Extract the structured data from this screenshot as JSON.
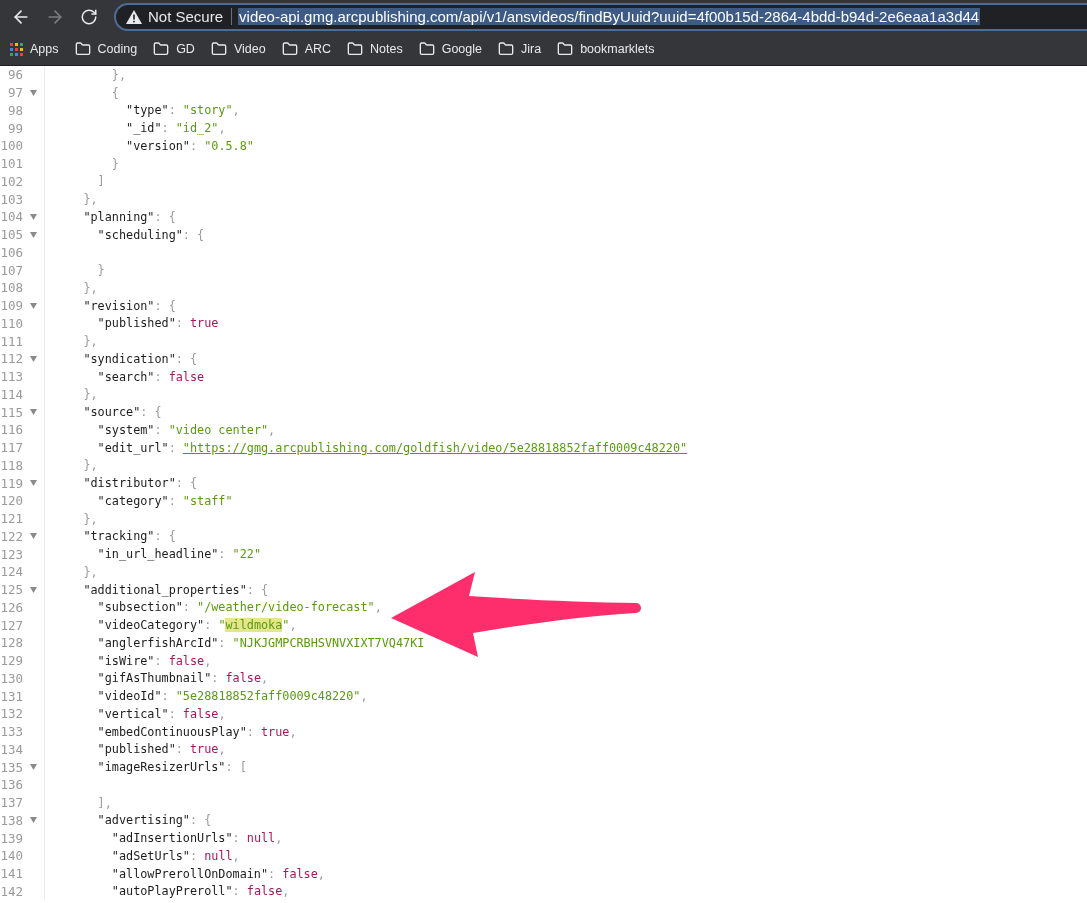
{
  "toolbar": {
    "security_label": "Not Secure",
    "url": "video-api.gmg.arcpublishing.com/api/v1/ansvideos/findByUuid?uuid=4f00b15d-2864-4bdd-b94d-2e6eaa1a3d44",
    "url_selected": true,
    "forward_disabled": true
  },
  "bookmarks": [
    {
      "label": "Apps",
      "kind": "apps"
    },
    {
      "label": "Coding",
      "kind": "folder"
    },
    {
      "label": "GD",
      "kind": "folder"
    },
    {
      "label": "Video",
      "kind": "folder"
    },
    {
      "label": "ARC",
      "kind": "folder"
    },
    {
      "label": "Notes",
      "kind": "folder"
    },
    {
      "label": "Google",
      "kind": "folder"
    },
    {
      "label": "Jira",
      "kind": "folder"
    },
    {
      "label": "bookmarklets",
      "kind": "folder"
    }
  ],
  "code": {
    "lines": [
      {
        "n": "96",
        "foldable": false,
        "text": [
          {
            "kind": "punct",
            "s": "        },"
          }
        ]
      },
      {
        "n": "97",
        "foldable": true,
        "text": [
          {
            "kind": "punct",
            "s": "        {"
          }
        ]
      },
      {
        "n": "98",
        "foldable": false,
        "text": [
          {
            "kind": "key",
            "s": "          \"type\""
          },
          {
            "kind": "punct",
            "s": ": "
          },
          {
            "kind": "str",
            "s": "\"story\""
          },
          {
            "kind": "punct",
            "s": ","
          }
        ]
      },
      {
        "n": "99",
        "foldable": false,
        "text": [
          {
            "kind": "key",
            "s": "          \"_id\""
          },
          {
            "kind": "punct",
            "s": ": "
          },
          {
            "kind": "str",
            "s": "\"id_2\""
          },
          {
            "kind": "punct",
            "s": ","
          }
        ]
      },
      {
        "n": "100",
        "foldable": false,
        "text": [
          {
            "kind": "key",
            "s": "          \"version\""
          },
          {
            "kind": "punct",
            "s": ": "
          },
          {
            "kind": "str",
            "s": "\"0.5.8\""
          }
        ]
      },
      {
        "n": "101",
        "foldable": false,
        "text": [
          {
            "kind": "punct",
            "s": "        }"
          }
        ]
      },
      {
        "n": "102",
        "foldable": false,
        "text": [
          {
            "kind": "punct",
            "s": "      ]"
          }
        ]
      },
      {
        "n": "103",
        "foldable": false,
        "text": [
          {
            "kind": "punct",
            "s": "    },"
          }
        ]
      },
      {
        "n": "104",
        "foldable": true,
        "text": [
          {
            "kind": "key",
            "s": "    \"planning\""
          },
          {
            "kind": "punct",
            "s": ": {"
          }
        ]
      },
      {
        "n": "105",
        "foldable": true,
        "text": [
          {
            "kind": "key",
            "s": "      \"scheduling\""
          },
          {
            "kind": "punct",
            "s": ": {"
          }
        ]
      },
      {
        "n": "106",
        "foldable": false
      },
      {
        "n": "107",
        "foldable": false,
        "text": [
          {
            "kind": "punct",
            "s": "      }"
          }
        ]
      },
      {
        "n": "108",
        "foldable": false,
        "text": [
          {
            "kind": "punct",
            "s": "    },"
          }
        ]
      },
      {
        "n": "109",
        "foldable": true,
        "text": [
          {
            "kind": "key",
            "s": "    \"revision\""
          },
          {
            "kind": "punct",
            "s": ": {"
          }
        ]
      },
      {
        "n": "110",
        "foldable": false,
        "text": [
          {
            "kind": "key",
            "s": "      \"published\""
          },
          {
            "kind": "punct",
            "s": ": "
          },
          {
            "kind": "lit",
            "s": "true"
          }
        ]
      },
      {
        "n": "111",
        "foldable": false,
        "text": [
          {
            "kind": "punct",
            "s": "    },"
          }
        ]
      },
      {
        "n": "112",
        "foldable": true,
        "text": [
          {
            "kind": "key",
            "s": "    \"syndication\""
          },
          {
            "kind": "punct",
            "s": ": {"
          }
        ]
      },
      {
        "n": "113",
        "foldable": false,
        "text": [
          {
            "kind": "key",
            "s": "      \"search\""
          },
          {
            "kind": "punct",
            "s": ": "
          },
          {
            "kind": "lit",
            "s": "false"
          }
        ]
      },
      {
        "n": "114",
        "foldable": false,
        "text": [
          {
            "kind": "punct",
            "s": "    },"
          }
        ]
      },
      {
        "n": "115",
        "foldable": true,
        "text": [
          {
            "kind": "key",
            "s": "    \"source\""
          },
          {
            "kind": "punct",
            "s": ": {"
          }
        ]
      },
      {
        "n": "116",
        "foldable": false,
        "text": [
          {
            "kind": "key",
            "s": "      \"system\""
          },
          {
            "kind": "punct",
            "s": ": "
          },
          {
            "kind": "str",
            "s": "\"video center\""
          },
          {
            "kind": "punct",
            "s": ","
          }
        ]
      },
      {
        "n": "117",
        "foldable": false,
        "text": [
          {
            "kind": "key",
            "s": "      \"edit_url\""
          },
          {
            "kind": "punct",
            "s": ": "
          },
          {
            "kind": "link",
            "s": "\"https://gmg.arcpublishing.com/goldfish/video/5e28818852faff0009c48220\""
          }
        ]
      },
      {
        "n": "118",
        "foldable": false,
        "text": [
          {
            "kind": "punct",
            "s": "    },"
          }
        ]
      },
      {
        "n": "119",
        "foldable": true,
        "text": [
          {
            "kind": "key",
            "s": "    \"distributor\""
          },
          {
            "kind": "punct",
            "s": ": {"
          }
        ]
      },
      {
        "n": "120",
        "foldable": false,
        "text": [
          {
            "kind": "key",
            "s": "      \"category\""
          },
          {
            "kind": "punct",
            "s": ": "
          },
          {
            "kind": "str",
            "s": "\"staff\""
          }
        ]
      },
      {
        "n": "121",
        "foldable": false,
        "text": [
          {
            "kind": "punct",
            "s": "    },"
          }
        ]
      },
      {
        "n": "122",
        "foldable": true,
        "text": [
          {
            "kind": "key",
            "s": "    \"tracking\""
          },
          {
            "kind": "punct",
            "s": ": {"
          }
        ]
      },
      {
        "n": "123",
        "foldable": false,
        "text": [
          {
            "kind": "key",
            "s": "      \"in_url_headline\""
          },
          {
            "kind": "punct",
            "s": ": "
          },
          {
            "kind": "str",
            "s": "\"22\""
          }
        ]
      },
      {
        "n": "124",
        "foldable": false,
        "text": [
          {
            "kind": "punct",
            "s": "    },"
          }
        ]
      },
      {
        "n": "125",
        "foldable": true,
        "text": [
          {
            "kind": "key",
            "s": "    \"additional_properties\""
          },
          {
            "kind": "punct",
            "s": ": {"
          }
        ]
      },
      {
        "n": "126",
        "foldable": false,
        "text": [
          {
            "kind": "key",
            "s": "      \"subsection\""
          },
          {
            "kind": "punct",
            "s": ": "
          },
          {
            "kind": "str",
            "s": "\"/weather/video-forecast\""
          },
          {
            "kind": "punct",
            "s": ","
          }
        ]
      },
      {
        "n": "127",
        "foldable": false,
        "text": [
          {
            "kind": "key",
            "s": "      \"videoCategory\""
          },
          {
            "kind": "punct",
            "s": ": "
          },
          {
            "kind": "str",
            "s": "\""
          },
          {
            "kind": "match",
            "s": "wildmoka"
          },
          {
            "kind": "str",
            "s": "\""
          },
          {
            "kind": "punct",
            "s": ","
          }
        ]
      },
      {
        "n": "128",
        "foldable": false,
        "text": [
          {
            "kind": "key",
            "s": "      \"anglerfishArcId\""
          },
          {
            "kind": "punct",
            "s": ": "
          },
          {
            "kind": "str",
            "s": "\"NJKJGMPCRBHSVNVXIXT7VQ47KI"
          }
        ]
      },
      {
        "n": "129",
        "foldable": false,
        "text": [
          {
            "kind": "key",
            "s": "      \"isWire\""
          },
          {
            "kind": "punct",
            "s": ": "
          },
          {
            "kind": "lit",
            "s": "false"
          },
          {
            "kind": "punct",
            "s": ","
          }
        ]
      },
      {
        "n": "130",
        "foldable": false,
        "text": [
          {
            "kind": "key",
            "s": "      \"gifAsThumbnail\""
          },
          {
            "kind": "punct",
            "s": ": "
          },
          {
            "kind": "lit",
            "s": "false"
          },
          {
            "kind": "punct",
            "s": ","
          }
        ]
      },
      {
        "n": "131",
        "foldable": false,
        "text": [
          {
            "kind": "key",
            "s": "      \"videoId\""
          },
          {
            "kind": "punct",
            "s": ": "
          },
          {
            "kind": "str",
            "s": "\"5e28818852faff0009c48220\""
          },
          {
            "kind": "punct",
            "s": ","
          }
        ]
      },
      {
        "n": "132",
        "foldable": false,
        "text": [
          {
            "kind": "key",
            "s": "      \"vertical\""
          },
          {
            "kind": "punct",
            "s": ": "
          },
          {
            "kind": "lit",
            "s": "false"
          },
          {
            "kind": "punct",
            "s": ","
          }
        ]
      },
      {
        "n": "133",
        "foldable": false,
        "text": [
          {
            "kind": "key",
            "s": "      \"embedContinuousPlay\""
          },
          {
            "kind": "punct",
            "s": ": "
          },
          {
            "kind": "lit",
            "s": "true"
          },
          {
            "kind": "punct",
            "s": ","
          }
        ]
      },
      {
        "n": "134",
        "foldable": false,
        "text": [
          {
            "kind": "key",
            "s": "      \"published\""
          },
          {
            "kind": "punct",
            "s": ": "
          },
          {
            "kind": "lit",
            "s": "true"
          },
          {
            "kind": "punct",
            "s": ","
          }
        ]
      },
      {
        "n": "135",
        "foldable": true,
        "text": [
          {
            "kind": "key",
            "s": "      \"imageResizerUrls\""
          },
          {
            "kind": "punct",
            "s": ": ["
          }
        ]
      },
      {
        "n": "136",
        "foldable": false
      },
      {
        "n": "137",
        "foldable": false,
        "text": [
          {
            "kind": "punct",
            "s": "      ],"
          }
        ]
      },
      {
        "n": "138",
        "foldable": true,
        "text": [
          {
            "kind": "key",
            "s": "      \"advertising\""
          },
          {
            "kind": "punct",
            "s": ": {"
          }
        ]
      },
      {
        "n": "139",
        "foldable": false,
        "text": [
          {
            "kind": "key",
            "s": "        \"adInsertionUrls\""
          },
          {
            "kind": "punct",
            "s": ": "
          },
          {
            "kind": "lit",
            "s": "null"
          },
          {
            "kind": "punct",
            "s": ","
          }
        ]
      },
      {
        "n": "140",
        "foldable": false,
        "text": [
          {
            "kind": "key",
            "s": "        \"adSetUrls\""
          },
          {
            "kind": "punct",
            "s": ": "
          },
          {
            "kind": "lit",
            "s": "null"
          },
          {
            "kind": "punct",
            "s": ","
          }
        ]
      },
      {
        "n": "141",
        "foldable": false,
        "text": [
          {
            "kind": "key",
            "s": "        \"allowPrerollOnDomain\""
          },
          {
            "kind": "punct",
            "s": ": "
          },
          {
            "kind": "lit",
            "s": "false"
          },
          {
            "kind": "punct",
            "s": ","
          }
        ]
      },
      {
        "n": "142",
        "foldable": false,
        "text": [
          {
            "kind": "key",
            "s": "        \"autoPlayPreroll\""
          },
          {
            "kind": "punct",
            "s": ": "
          },
          {
            "kind": "lit",
            "s": "false"
          },
          {
            "kind": "punct",
            "s": ","
          }
        ]
      }
    ]
  }
}
